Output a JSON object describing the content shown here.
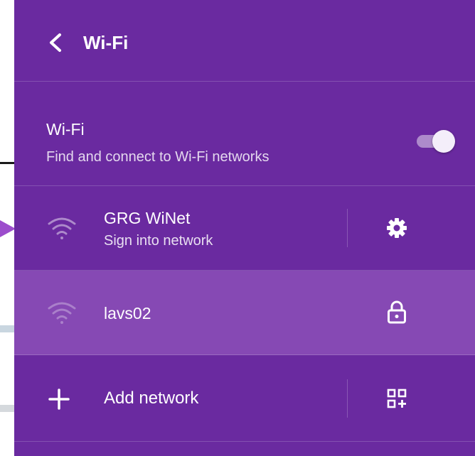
{
  "header": {
    "title": "Wi-Fi",
    "back_icon": "chevron-left-icon"
  },
  "wifi_toggle": {
    "title": "Wi-Fi",
    "subtitle": "Find and connect to Wi-Fi networks",
    "enabled": true
  },
  "networks": [
    {
      "name": "GRG WiNet",
      "status": "Sign into network",
      "signal_icon": "wifi-signal-icon",
      "action_icon": "gear-icon",
      "selected": false
    },
    {
      "name": "lavs02",
      "status": "",
      "signal_icon": "wifi-signal-icon",
      "action_icon": "lock-icon",
      "selected": true
    }
  ],
  "add_network": {
    "label": "Add network",
    "icon": "plus-icon",
    "action_icon": "qr-code-scan-icon"
  },
  "colors": {
    "panel_bg": "#6a2aa0",
    "selected_row_bg": "#8649b4",
    "text": "#ffffff",
    "toggle_thumb": "#f4eefa",
    "left_arrow": "#9c4dcc"
  }
}
